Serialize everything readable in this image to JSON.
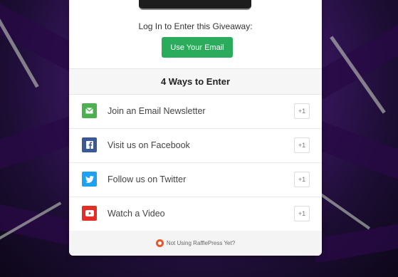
{
  "giveaway": {
    "login_prompt": "Log In to Enter this Giveaway:",
    "email_button": "Use Your Email",
    "ways_title": "4 Ways to Enter",
    "entries": [
      {
        "label": "Join an Email Newsletter",
        "points": "+1",
        "icon": "envelope-icon",
        "color": "#4caf50"
      },
      {
        "label": "Visit us on Facebook",
        "points": "+1",
        "icon": "facebook-icon",
        "color": "#3b5998"
      },
      {
        "label": "Follow us on Twitter",
        "points": "+1",
        "icon": "twitter-icon",
        "color": "#1da1f2"
      },
      {
        "label": "Watch a Video",
        "points": "+1",
        "icon": "youtube-icon",
        "color": "#e52d27"
      }
    ],
    "footer_text": "Not Using RafflePress Yet?",
    "brand_color": "#e8562c",
    "button_color": "#2aac5c"
  }
}
